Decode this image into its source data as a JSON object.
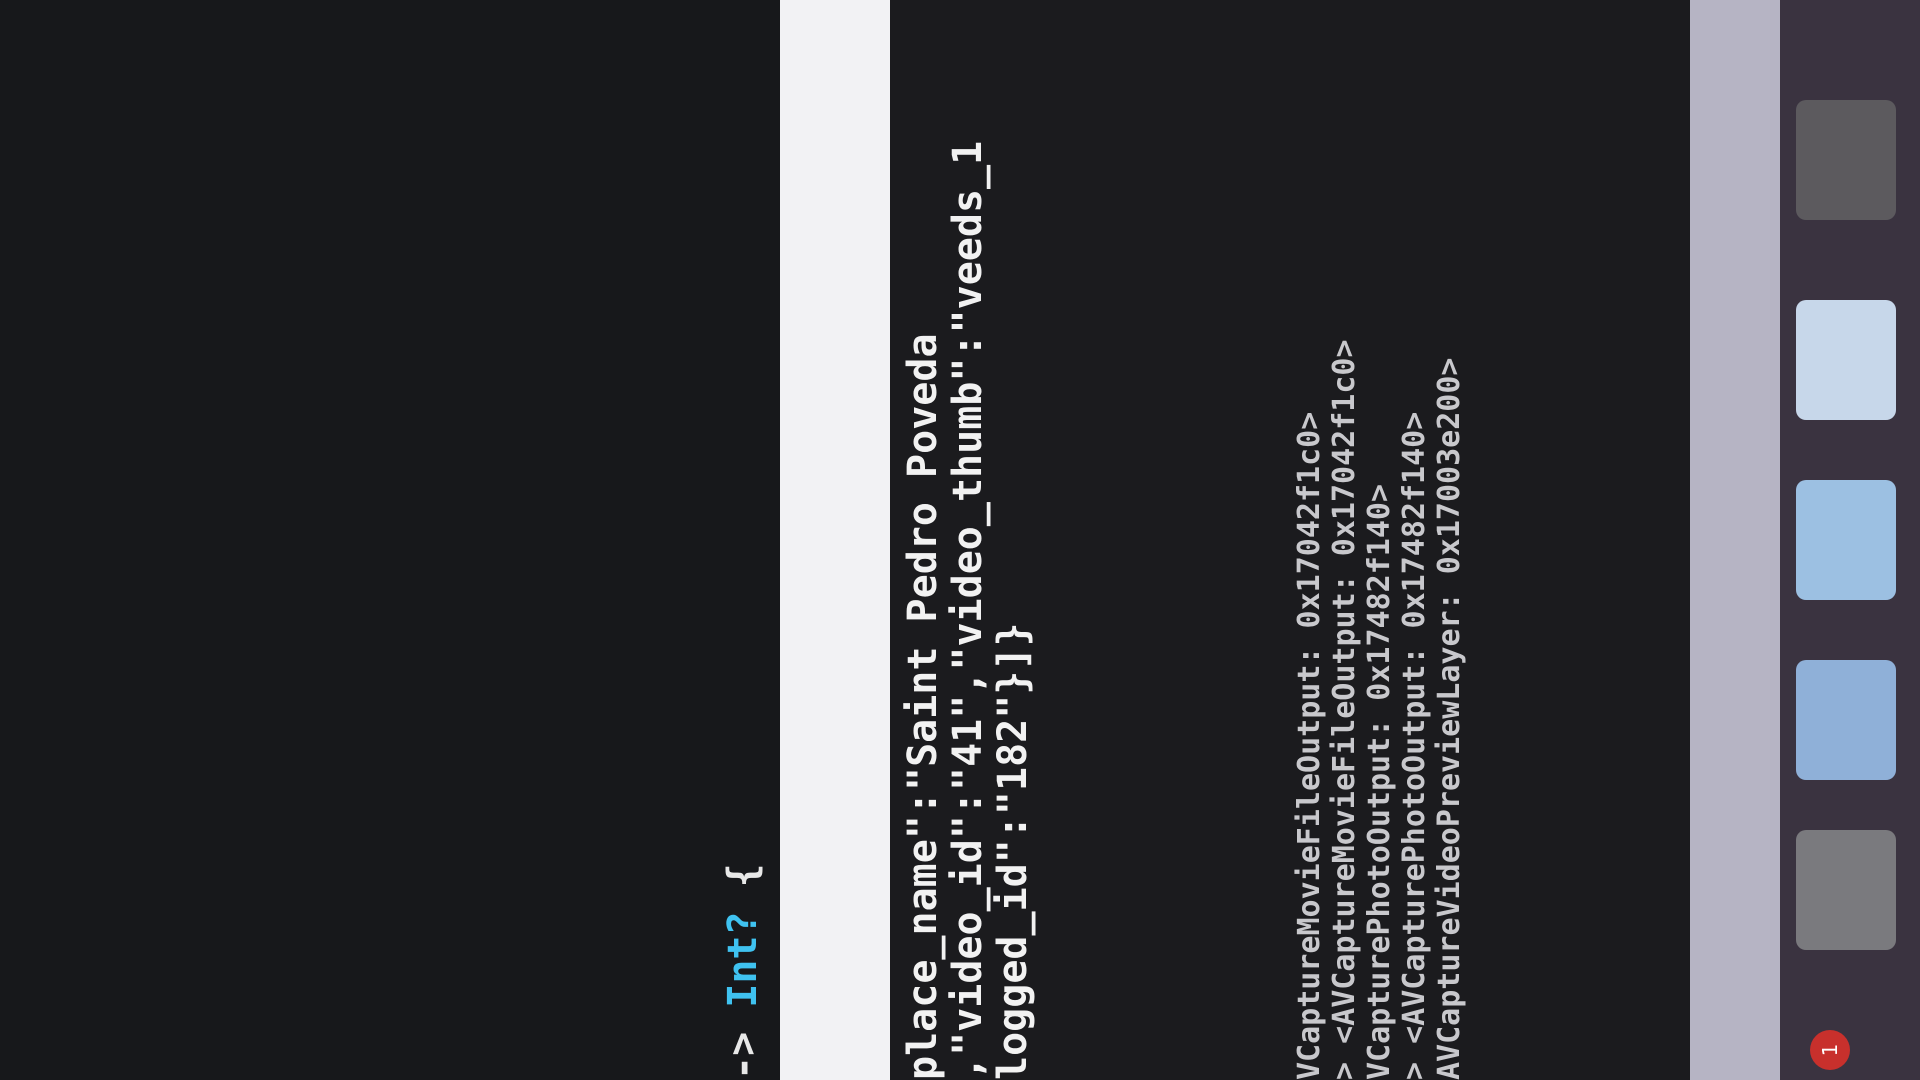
{
  "editor": {
    "code_arrow": "-> ",
    "return_type": "Int?",
    "open_brace": " {"
  },
  "console": {
    "json_lines": [
      "place_name\":\"Saint Pedro Poveda",
      ",\"video_id\":\"41\",\"video_thumb\":\"veeds_1",
      "logged_id\":\"182\"}]}"
    ],
    "log_lines": [
      "VCaptureMovieFileOutput: 0x17042f1c0>",
      "> <AVCaptureMovieFileOutput: 0x17042f1c0>",
      "VCapturePhotoOutput: 0x17482f140>",
      "> <AVCapturePhotoOutput: 0x17482f140>",
      "AVCaptureVideoPreviewLayer: 0x17003e200>"
    ]
  },
  "dock": {
    "badge": "1"
  },
  "colors": {
    "background": "#0d0d0f",
    "type_keyword": "#3fc2f0",
    "divider": "#f2f2f4",
    "sidebar": "#b6b4c4",
    "badge": "#c8302c"
  }
}
